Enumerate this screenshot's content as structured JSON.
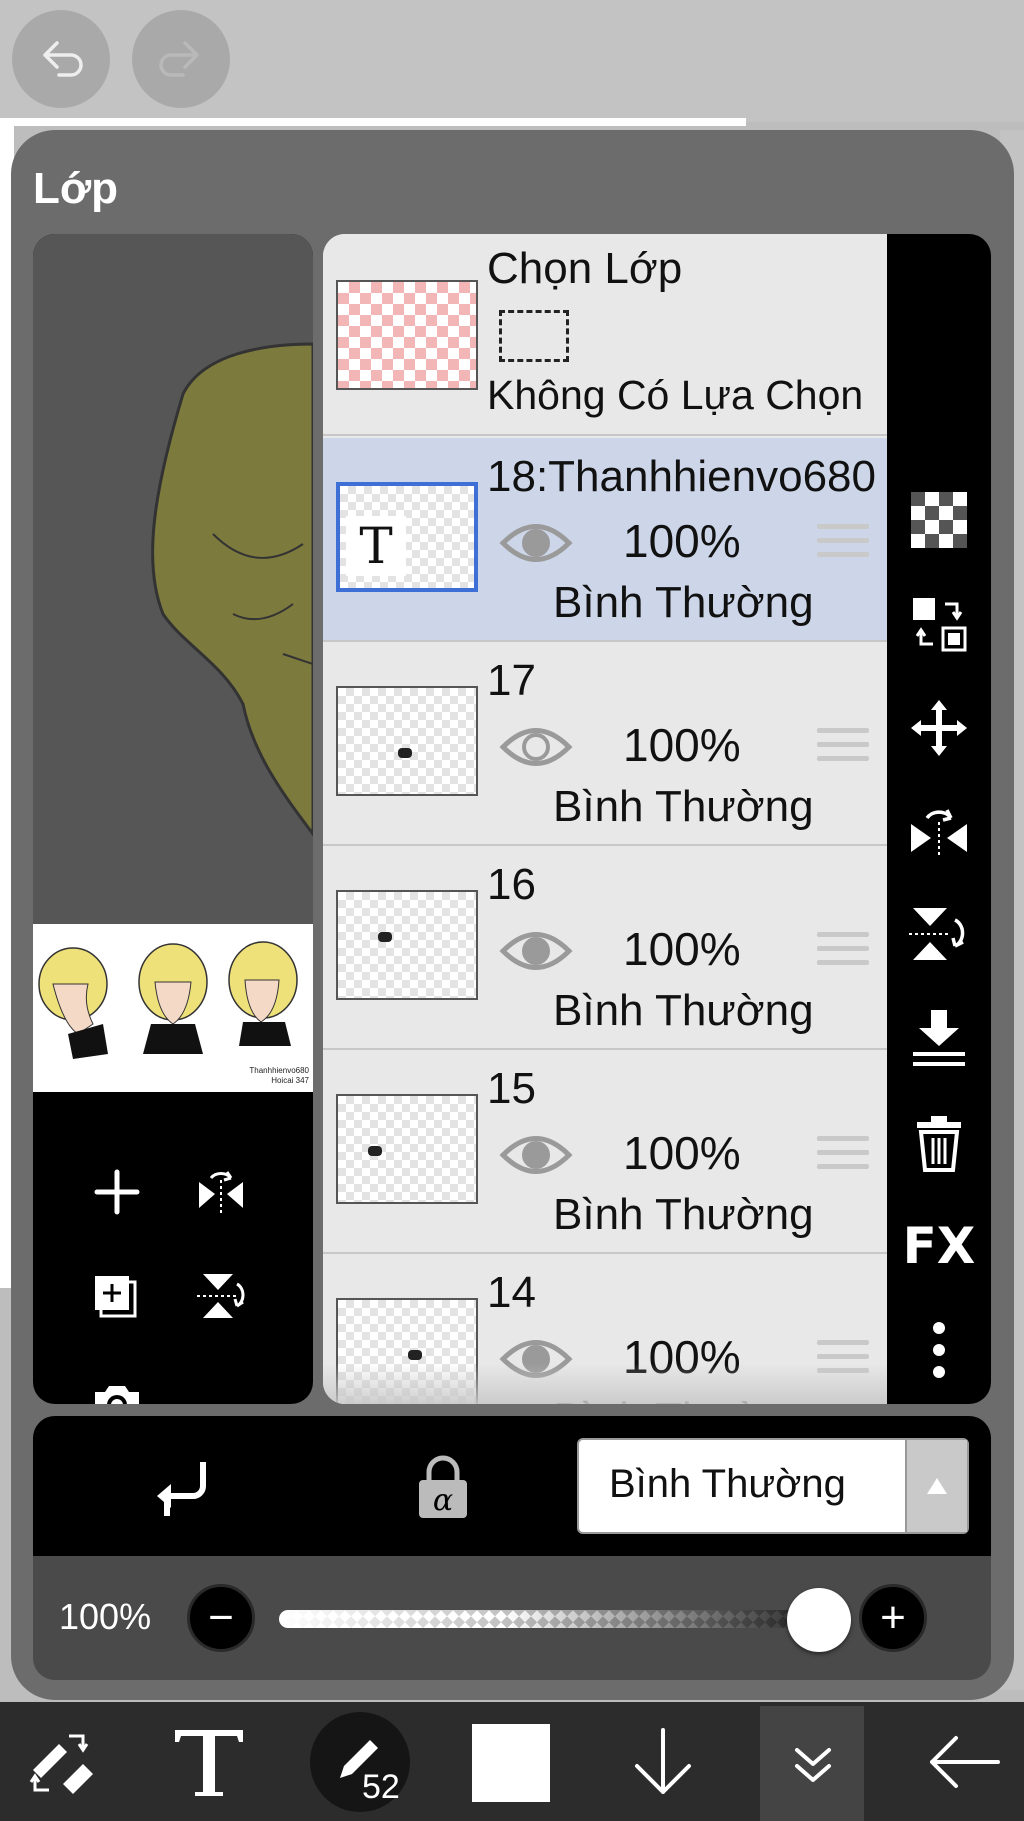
{
  "panel": {
    "title": "Lớp"
  },
  "selection_layer": {
    "title": "Chọn Lớp",
    "subtitle": "Không Có Lựa Chọn"
  },
  "layers": [
    {
      "name": "18:Thanhhienvo680",
      "opacity": "100%",
      "blend_mode": "Bình Thường",
      "visible": true,
      "selected": true,
      "thumb_text": "T"
    },
    {
      "name": "17",
      "opacity": "100%",
      "blend_mode": "Bình Thường",
      "visible": true,
      "selected": false
    },
    {
      "name": "16",
      "opacity": "100%",
      "blend_mode": "Bình Thường",
      "visible": true,
      "selected": false
    },
    {
      "name": "15",
      "opacity": "100%",
      "blend_mode": "Bình Thường",
      "visible": true,
      "selected": false
    },
    {
      "name": "14",
      "opacity": "100%",
      "blend_mode": "Bình Thường",
      "visible": true,
      "selected": false
    }
  ],
  "preview": {
    "caption_line1": "Thanhhienvo680",
    "caption_line2": "Hoicai 347"
  },
  "blend": {
    "current": "Bình Thường"
  },
  "opacity_control": {
    "label": "100%",
    "value_fraction": 1.0,
    "minus": "−",
    "plus": "+"
  },
  "bottom_bar": {
    "brush_size": "52"
  },
  "icons": [
    "undo-icon",
    "redo-icon",
    "add-layer-icon",
    "flip-horizontal-icon",
    "duplicate-layer-icon",
    "flip-vertical-icon",
    "camera-icon",
    "transparency-icon",
    "swap-layers-icon",
    "move-icon",
    "flip-icon",
    "flip-down-icon",
    "merge-down-icon",
    "trash-icon",
    "fx-icon",
    "more-icon",
    "clipping-icon",
    "alpha-lock-icon",
    "eye-icon",
    "handle-icon",
    "transform-icon",
    "text-icon",
    "brush-icon",
    "download-arrow-icon",
    "collapse-icon",
    "back-arrow-icon"
  ],
  "colors": {
    "selected_row": "#cdd6e8",
    "selection_border": "#3d6fd6",
    "panel_bg": "#6c6c6c",
    "toolbar_bg": "#000000"
  },
  "fx_label": "FX"
}
